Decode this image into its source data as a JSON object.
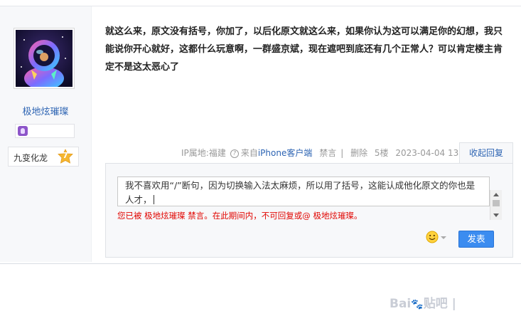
{
  "author": {
    "username": "极地炫璀璨",
    "level_title": "九变化龙",
    "level": "7"
  },
  "post": {
    "content": "就这么来，原文没有括号，你加了，以后化原文就这么来，如果你认为这可以满足你的幻想，我只能说你开心就好，这都什么玩意啊，一群盛京斌，现在遮吧到底还有几个正常人？可以肯定楼主肯定不是这太恶心了"
  },
  "meta": {
    "ip": "IP属地:福建",
    "source_prefix": "来自",
    "client": "iPhone客户端",
    "mute": "禁言",
    "separator": "|",
    "delete": "删除",
    "floor": "5楼",
    "time": "2023-04-04 13:58",
    "collapse": "收起回复"
  },
  "reply": {
    "input_value": "我不喜欢用“/”断句，因为切换输入法太麻烦，所以用了括号，这能认成他化原文的你也是人才，",
    "warning": "您已被 极地炫璀璨 禁言。在此期间内，不可回复或@ 极地炫璀璨。",
    "send_label": "发表"
  },
  "watermark": {
    "text": "Bai",
    "text2": "贴吧",
    "separator": "|"
  },
  "colors": {
    "link": "#2d64b3",
    "warning": "#e10602",
    "send": "#3b8cf0",
    "level_badge": "#f5b731"
  },
  "icons": [
    "avatar-image",
    "member-badge-icon",
    "level-star-icon",
    "help-icon",
    "emoji-icon",
    "chevron-down-icon",
    "baidu-paw-icon"
  ]
}
